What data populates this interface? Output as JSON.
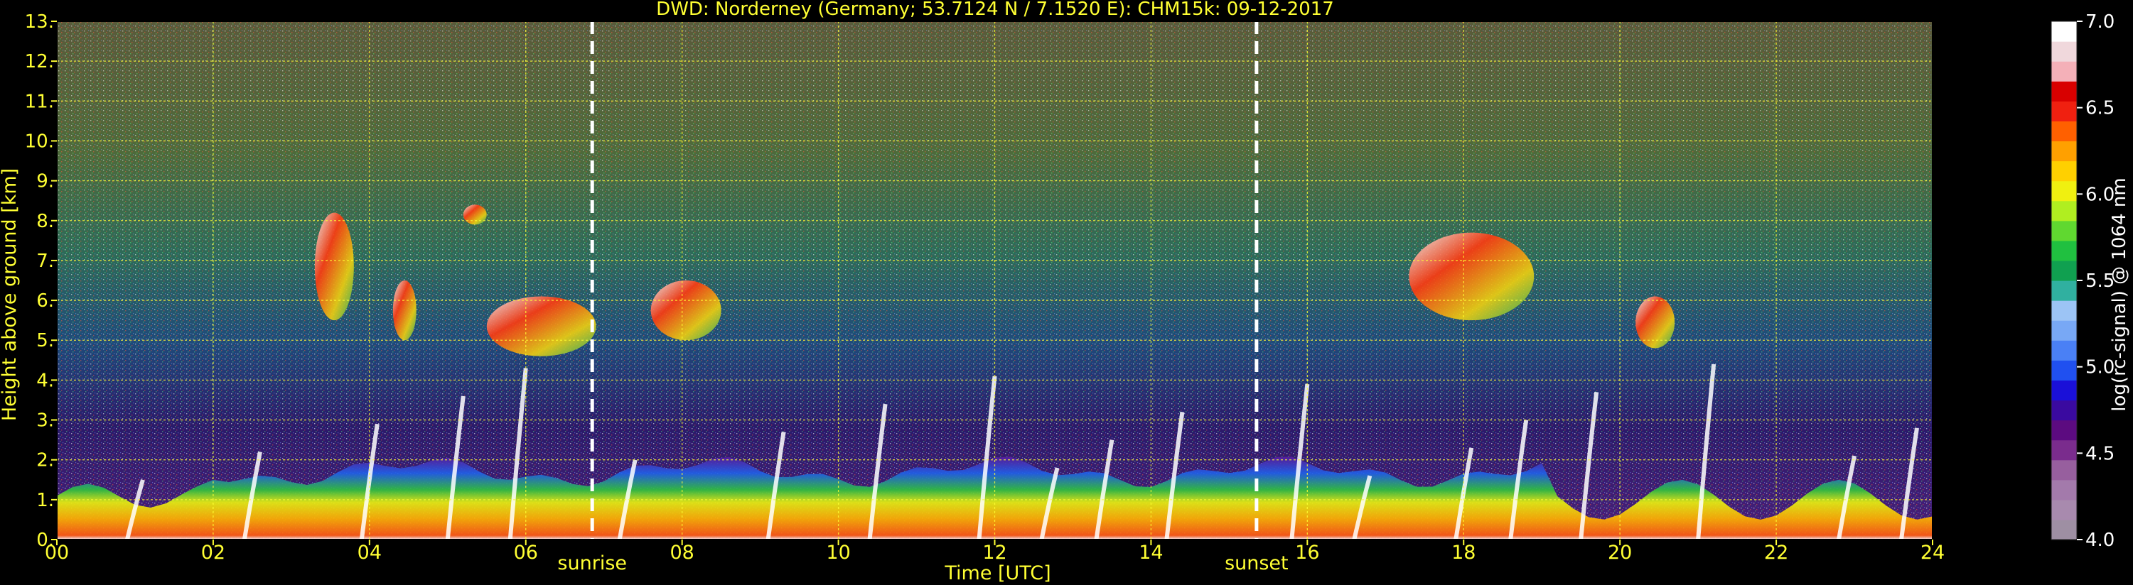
{
  "chart_data": {
    "type": "heatmap",
    "title": "DWD: Norderney (Germany; 53.7124 N / 7.1520 E):    CHM15k: 09-12-2017",
    "xlabel": "Time [UTC]",
    "ylabel": "Height above ground [km]",
    "xlim": [
      0,
      24
    ],
    "ylim": [
      0,
      13
    ],
    "x_ticks": [
      "00",
      "02",
      "04",
      "06",
      "08",
      "10",
      "12",
      "14",
      "16",
      "18",
      "20",
      "22",
      "24"
    ],
    "y_ticks": [
      "0.",
      "1.",
      "2.",
      "3.",
      "4.",
      "5.",
      "6.",
      "7.",
      "8.",
      "9.",
      "10.",
      "11.",
      "12.",
      "13."
    ],
    "grid": true,
    "markers": [
      {
        "label": "sunrise",
        "x": 6.85
      },
      {
        "label": "sunset",
        "x": 15.35
      }
    ],
    "colorbar": {
      "label": "log(rc-signal) @ 1064 nm",
      "range": [
        4.0,
        7.0
      ],
      "ticks": [
        "4.0",
        "4.5",
        "5.0",
        "5.5",
        "6.0",
        "6.5",
        "7.0"
      ],
      "colors": [
        "#9e8fa3",
        "#a88aae",
        "#a37aab",
        "#975f9e",
        "#7a2c8d",
        "#5c0b80",
        "#3a0aa0",
        "#1a10d8",
        "#2050f0",
        "#4a80f5",
        "#78a8f5",
        "#9cc4f5",
        "#30b0a0",
        "#10a050",
        "#20c040",
        "#60d830",
        "#b0ee20",
        "#f0f010",
        "#ffd000",
        "#ffa000",
        "#ff6000",
        "#f02010",
        "#d80000",
        "#f4b0b8",
        "#f0d8dc",
        "#ffffff"
      ]
    },
    "features": {
      "boundary_layer": "0-2 km, dense high signal (yellow/orange near surface, green/blue above) most of the day, thinning after 19 UTC",
      "cloud_layers": [
        {
          "x": [
            3.3,
            3.8
          ],
          "y": [
            5.5,
            8.2
          ]
        },
        {
          "x": [
            4.3,
            4.6
          ],
          "y": [
            5.0,
            6.5
          ]
        },
        {
          "x": [
            5.2,
            5.5
          ],
          "y": [
            7.9,
            8.4
          ]
        },
        {
          "x": [
            5.5,
            6.9
          ],
          "y": [
            4.6,
            6.1
          ]
        },
        {
          "x": [
            7.6,
            8.5
          ],
          "y": [
            5.0,
            6.5
          ]
        },
        {
          "x": [
            17.3,
            18.9
          ],
          "y": [
            5.5,
            7.7
          ]
        },
        {
          "x": [
            20.2,
            20.7
          ],
          "y": [
            4.8,
            6.1
          ]
        }
      ]
    }
  }
}
